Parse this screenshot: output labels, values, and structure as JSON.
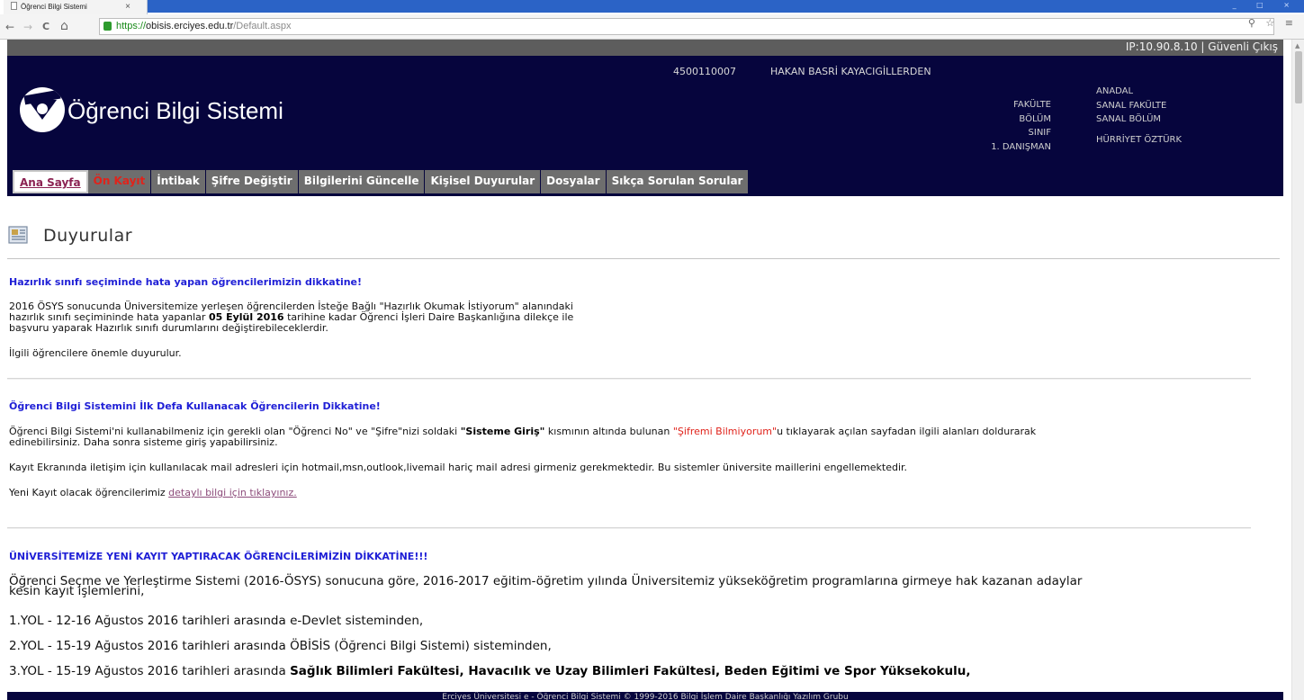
{
  "browser": {
    "tab_title": "Öğrenci Bilgi Sistemi",
    "tab_close": "×",
    "url_scheme": "https://",
    "url_host": "obisis.erciyes.edu.tr",
    "url_path": "/Default.aspx",
    "back": "←",
    "forward": "→",
    "reload": "C",
    "home": "⌂",
    "omni_icons": "⚲ ☆ ≡"
  },
  "header": {
    "ip_logout": "IP:10.90.8.10 | Güvenli Çıkış",
    "student_no": "4500110007",
    "student_name": "HAKAN BASRİ KAYACIGİLLERDEN",
    "app_title": "Öğrenci Bilgi Sistemi",
    "info_labels": [
      "FAKÜLTE",
      "BÖLÜM",
      "SINIF",
      "1. DANIŞMAN"
    ],
    "info_values": {
      "program": "ANADAL",
      "faculty": "SANAL FAKÜLTE",
      "department": "SANAL BÖLÜM",
      "advisor": "HÜRRİYET ÖZTÜRK"
    }
  },
  "menu": {
    "items": [
      "Ana Sayfa",
      "Ön Kayıt",
      "İntibak",
      "Şifre Değiştir",
      "Bilgilerini Güncelle",
      "Kişisel Duyurular",
      "Dosyalar",
      "Sıkça Sorulan Sorular"
    ]
  },
  "section": {
    "title": "Duyurular"
  },
  "announcements": {
    "a1": {
      "heading": "Hazırlık sınıfı seçiminde hata yapan öğrencilerimizin dikkatine!",
      "line1": "2016 ÖSYS sonucunda Üniversitemize yerleşen öğrencilerden İsteğe Bağlı \"Hazırlık Okumak İstiyorum\" alanındaki",
      "line2_pre": "hazırlık sınıfı seçimininde hata yapanlar ",
      "line2_bold": "05 Eylül 2016",
      "line2_post": " tarihine kadar Öğrenci İşleri Daire Başkanlığına dilekçe ile",
      "line3": "başvuru yaparak Hazırlık sınıfı durumlarını değiştirebileceklerdir.",
      "line4": "İlgili öğrencilere önemle duyurulur."
    },
    "a2": {
      "heading": "Öğrenci Bilgi Sistemini İlk Defa Kullanacak Öğrencilerin Dikkatine!",
      "p1_pre": "Öğrenci Bilgi Sistemi'ni kullanabilmeniz için gerekli olan \"Öğrenci No\" ve \"Şifre\"nizi soldaki ",
      "p1_bold": "\"Sisteme Giriş\"",
      "p1_mid": " kısmının altında bulunan ",
      "p1_red": "\"Şifremi Bilmiyorum\"",
      "p1_post": "u tıklayarak açılan sayfadan ilgili alanları doldurarak",
      "p1_line2": "edinebilirsiniz. Daha sonra sisteme giriş yapabilirsiniz.",
      "p2": "Kayıt Ekranında iletişim için kullanılacak mail adresleri için hotmail,msn,outlook,livemail hariç mail adresi girmeniz gerekmektedir. Bu sistemler üniversite maillerini engellemektedir.",
      "p3_pre": "Yeni Kayıt olacak öğrencilerimiz ",
      "p3_link": "detaylı bilgi için tıklayınız."
    },
    "a3": {
      "heading": "ÜNİVERSİTEMİZE YENİ KAYIT YAPTIRACAK ÖĞRENCİLERİMİZİN DİKKATİNE!!!",
      "p1_line1": "Öğrenci Seçme ve Yerleştirme Sistemi (2016-ÖSYS) sonucuna göre, 2016-2017 eğitim-öğretim yılında Üniversitemiz yükseköğretim programlarına girmeye hak kazanan adaylar",
      "p1_line2": "kesin kayıt işlemlerini,",
      "yol1": "1.YOL - 12-16 Ağustos 2016 tarihleri arasında e-Devlet sisteminden,",
      "yol2": "2.YOL - 15-19 Ağustos 2016 tarihleri arasında ÖBİSİS (Öğrenci Bilgi Sistemi) sisteminden,",
      "yol3_pre": "3.YOL - 15-19 Ağustos 2016 tarihleri arasında ",
      "yol3_bold": "Sağlık Bilimleri Fakültesi, Havacılık ve Uzay Bilimleri Fakültesi, Beden Eğitimi ve Spor Yüksekokulu,"
    }
  },
  "footer": {
    "text": "Erciyes Üniversitesi e - Öğrenci Bilgi Sistemi © 1999-2016 Bilgi İşlem Daire Başkanlığı Yazılım Grubu"
  },
  "colors": {
    "header_bg": "#06053d",
    "heading_blue": "#1f1fd6",
    "warning_red": "#e0231b",
    "link_purple": "#8c4b7a",
    "menu_gray": "#6e6e6e"
  }
}
